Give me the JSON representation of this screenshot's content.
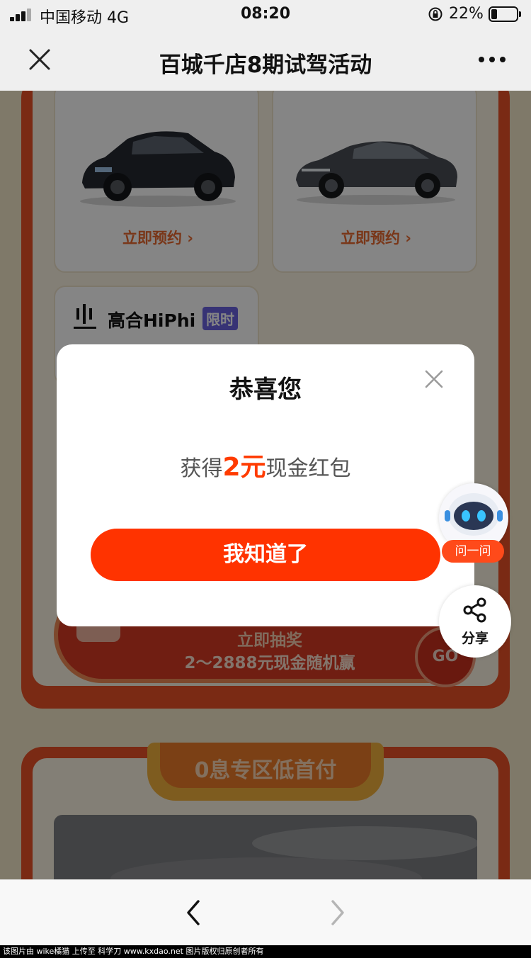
{
  "status_bar": {
    "carrier": "中国移动",
    "network": "4G",
    "time": "08:20",
    "battery": "22%"
  },
  "nav": {
    "title": "百城千店8期试驾活动",
    "close_icon": "close-icon",
    "more_icon": "more-dots-icon"
  },
  "cards": [
    {
      "reserve_label": "立即预约 ›"
    },
    {
      "reserve_label": "立即预约 ›"
    }
  ],
  "hiphi_card": {
    "brand_name": "高合HiPhi",
    "tag": "限时"
  },
  "lottery": {
    "title": "立即抽奖",
    "subtitle": "2～2888元现金随机赢",
    "go_label": "GO"
  },
  "section2": {
    "title": "0息专区低首付"
  },
  "modal": {
    "title": "恭喜您",
    "message_prefix": "获得",
    "amount": "2元",
    "message_suffix": "现金红包",
    "button": "我知道了"
  },
  "assistant": {
    "label": "问一问"
  },
  "share": {
    "label": "分享"
  },
  "watermark": "该图片由 wike橘猫 上传至 科学刀 www.kxdao.net 图片版权归原创者所有",
  "colors": {
    "accent": "#ff3300",
    "frame_red": "#ea5228",
    "page_bg": "#f4e8c9"
  }
}
